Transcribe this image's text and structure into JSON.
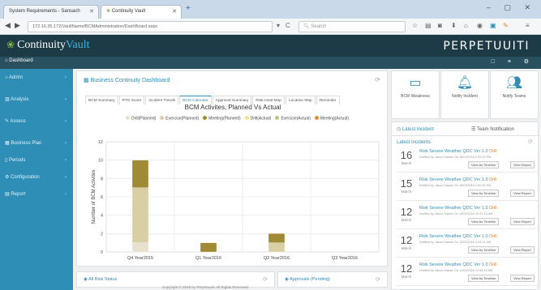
{
  "browser": {
    "tabs": [
      {
        "label": "System Requirements - Sansach"
      },
      {
        "label": "Continuity Vault"
      }
    ],
    "new_tab": "+",
    "window_controls": "– ▢ ✕",
    "url": "172.16.35.172/VaultName/BCMAdministration/DashBoard.aspx",
    "search_placeholder": "Search",
    "back": "◀",
    "forward": "▶",
    "reload": "C"
  },
  "app": {
    "logo_text": "Continuity",
    "logo_accent": "Vault",
    "brand": "PERPETUUITI",
    "dashboard_label": "Dashboard",
    "right_icons": "□ ≡ ⚙"
  },
  "sidebar": {
    "items": [
      {
        "label": "Admin"
      },
      {
        "label": "Analysis"
      },
      {
        "label": "Assess"
      },
      {
        "label": "Business Plan"
      },
      {
        "label": "Periods"
      },
      {
        "label": "Configuration"
      },
      {
        "label": "Report"
      }
    ]
  },
  "dashboard": {
    "title": "Business Continuity Dashboard",
    "tabs": [
      "BCM Summary",
      "RTO Score",
      "Incident Trends",
      "BCM Calendar",
      "Approval Summary",
      "Risk Heat Map",
      "Location Map",
      "Reminder"
    ],
    "active_tab_index": 3
  },
  "chart_data": {
    "type": "bar",
    "title": "BCM Activites, Planned Vs Actual",
    "ylabel": "Number of BCM Activites",
    "xlabel": "",
    "ylim": [
      0,
      12
    ],
    "yticks": [
      0,
      2,
      4,
      6,
      8,
      10,
      12
    ],
    "grid": true,
    "legend": "top",
    "categories": [
      "Q4 Year2015",
      "Q1 Year2016",
      "Q2 Year2016",
      "Q3 Year2016"
    ],
    "stacking": "stacked",
    "series": [
      {
        "name": "Drill(Planned)",
        "color": "#e7e2cf",
        "values": [
          1,
          0,
          0,
          0
        ]
      },
      {
        "name": "Exercise(Planned)",
        "color": "#d8cfa4",
        "values": [
          6,
          0,
          1,
          0
        ]
      },
      {
        "name": "Meeting(Planned)",
        "color": "#a18a35",
        "values": [
          3,
          1,
          1,
          0
        ]
      },
      {
        "name": "Drill(Actual)",
        "color": "#f2e784",
        "values": [
          0,
          0,
          0,
          0
        ]
      },
      {
        "name": "Exercise(Actual)",
        "color": "#c6bf7c",
        "values": [
          0,
          0,
          0,
          0
        ]
      },
      {
        "name": "Meeting(Actual)",
        "color": "#e08a3a",
        "values": [
          0,
          0,
          0,
          0
        ]
      }
    ]
  },
  "quick_actions": [
    {
      "label": "BCM Weakness",
      "icon": "monitor-icon"
    },
    {
      "label": "Notify Incident",
      "icon": "bell-icon"
    },
    {
      "label": "Notify Teams",
      "icon": "team-icon"
    }
  ],
  "incidents_panel": {
    "tabs": [
      "Latest Incident",
      "Team Notification"
    ],
    "heading": "Latest Incidents",
    "items": [
      {
        "day": "16",
        "month": "March",
        "title": "Risk Severe Weather QDC Ver 1.0",
        "sev": "Drill",
        "sub": "Notified by Jasus Hawan On 16/03/2016 2:00:00 PM",
        "btn1": "View As Timeline",
        "btn2": "View Report"
      },
      {
        "day": "15",
        "month": "March",
        "title": "Risk Severe Weather QDC Ver 1.0",
        "sev": "Drill",
        "sub": "Notified by Jasus Hawan On 15/03/2016 2:00:00 PM",
        "btn1": "View As Timeline",
        "btn2": "View Report"
      },
      {
        "day": "12",
        "month": "March",
        "title": "Risk Severe Weather QDC Ver 1.0",
        "sev": "Drill",
        "sub": "Notified by Jasus Hawan On 12/03/2016 10:21:13 AM",
        "btn1": "View As Timeline",
        "btn2": "View Report"
      },
      {
        "day": "12",
        "month": "March",
        "title": "Risk Severe Weather QDC Ver 1.0",
        "sev": "Drill",
        "sub": "Notified by Jasus Hawan On 12/03/2016 1:04:01 AM",
        "btn1": "View As Timeline",
        "btn2": "View Report"
      },
      {
        "day": "12",
        "month": "March",
        "title": "Risk Severe Weather QDC Ver 1.0",
        "sev": "Drill",
        "sub": "Notified by Jasus Hawan On 12/03/2016 12:58:16 AM",
        "btn1": "View As Timeline",
        "btn2": "View Report"
      }
    ]
  },
  "bottom": {
    "left_title": "All Risk Status",
    "right_title": "Approvals (Pending)"
  },
  "footer": "Copyright © 2016 by Perpetuuiti. All Rights Reserved."
}
